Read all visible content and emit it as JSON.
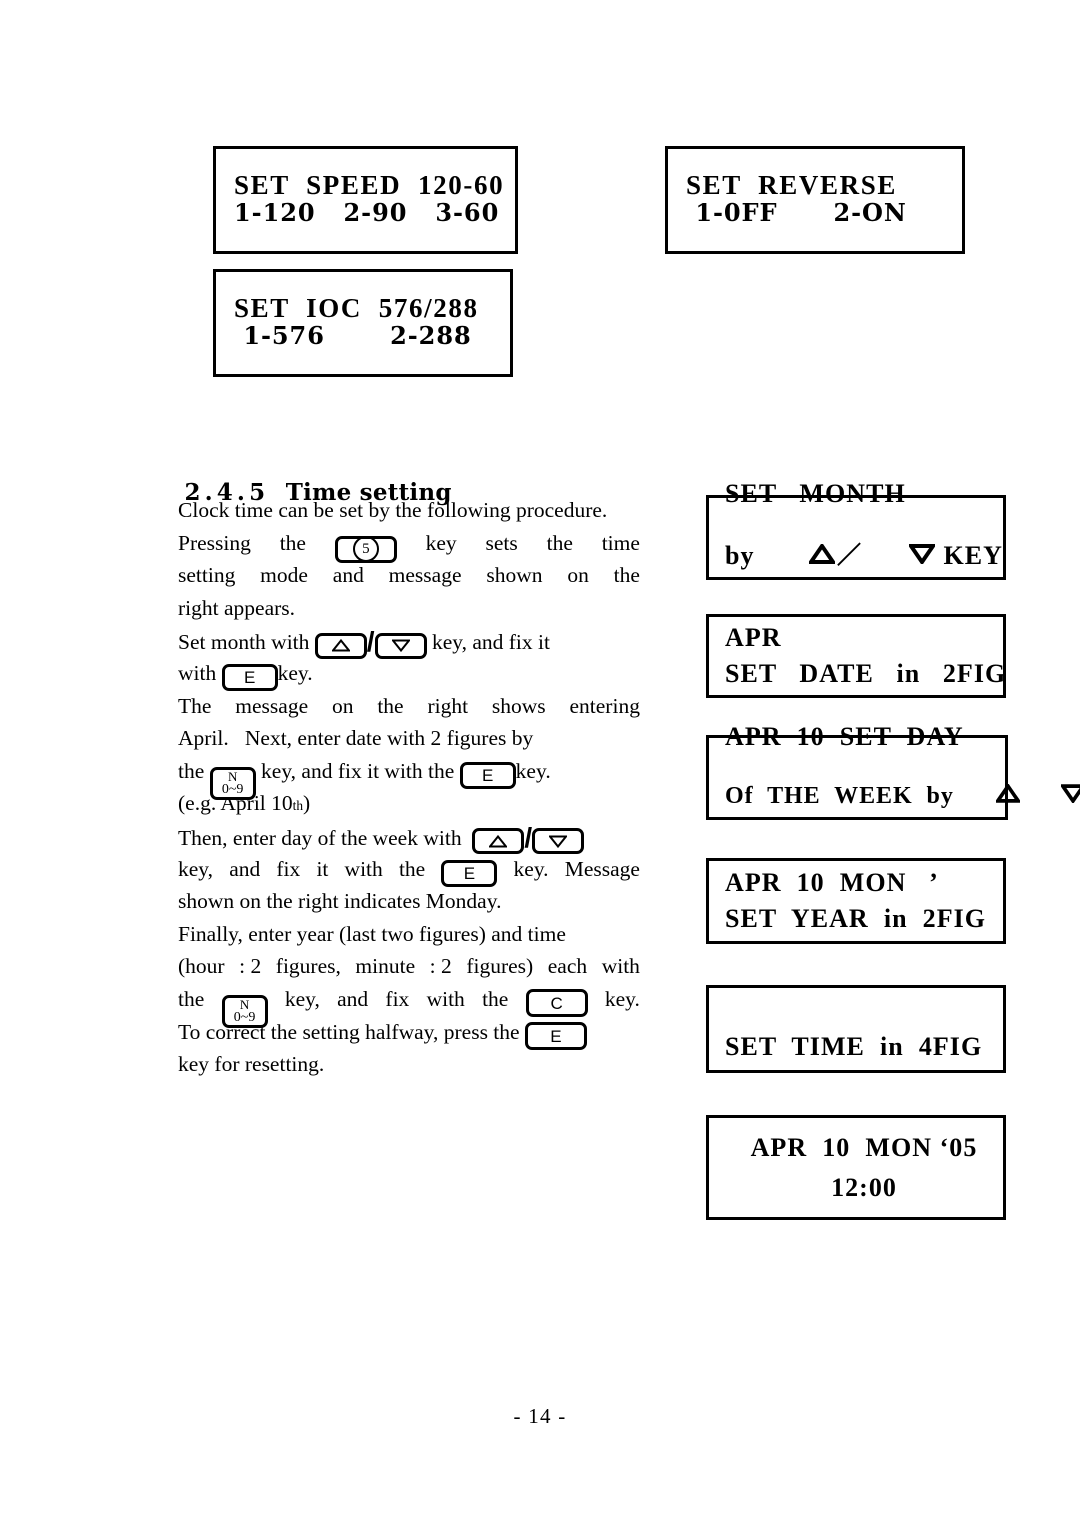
{
  "page": {
    "footer": "- 14 -"
  },
  "top_displays": [
    {
      "id": "set-speed",
      "line1": "SET  SPEED  120-60",
      "line2": "1-120   2-90   3-60"
    },
    {
      "id": "set-reverse",
      "line1": "SET  REVERSE",
      "line2": " 1-0FF      2-ON"
    },
    {
      "id": "set-ioc",
      "line1": "SET  IOC  576/288",
      "line2": " 1-576       2-288"
    }
  ],
  "section": {
    "number": "2.4.5",
    "title": "Time setting"
  },
  "body": {
    "p1": {
      "l1": "Clock time can be set by the following procedure.",
      "l2_a": "Pressing",
      "l2_b": "the",
      "l2_c": "key",
      "l2_d": "sets",
      "l2_e": "the",
      "l2_f": "time",
      "l3_a": "setting",
      "l3_b": "mode",
      "l3_c": "and",
      "l3_d": "message",
      "l3_e": "shown",
      "l3_f": "on",
      "l3_g": "the",
      "l4": "right appears."
    },
    "p2": {
      "l1_a": "Set month with",
      "l1_b": "key, and fix it",
      "l2_a": "with",
      "l2_b": "key."
    },
    "p3": {
      "l1_a": "The",
      "l1_b": "message",
      "l1_c": "on",
      "l1_d": "the",
      "l1_e": "right",
      "l1_f": "shows",
      "l1_g": "entering",
      "l2": "April.   Next, enter date with 2 figures by",
      "l3_a": "the",
      "l3_b": "key, and fix it with the",
      "l3_c": "key.",
      "l4_a": "(e.g. April 10",
      "l4_sup": "th",
      "l4_b": ")",
      "l5_a": "Then, enter day of the week with",
      "l6_a": "key,",
      "l6_b": "and",
      "l6_c": "fix",
      "l6_d": "it",
      "l6_e": "with",
      "l6_f": "the",
      "l6_g": "key.",
      "l6_h": "Message",
      "l7": "shown on the right indicates Monday."
    },
    "p4": {
      "l1": "Finally, enter year (last two figures) and time",
      "l2_a": "(hour",
      "l2_b": ": 2",
      "l2_c": "figures,",
      "l2_d": "minute",
      "l2_e": ": 2",
      "l2_f": "figures)",
      "l2_g": "each",
      "l2_h": "with",
      "l3_a": "the",
      "l3_b": "key,",
      "l3_c": "and",
      "l3_d": "fix",
      "l3_e": "with",
      "l3_f": "the",
      "l3_g": "key.",
      "l4_a": "To correct the setting halfway, press the",
      "l5": "key for resetting."
    }
  },
  "keys": {
    "five": "5",
    "enter": "E",
    "clear": "C",
    "numeric_top": "N",
    "numeric_bottom": "0~9",
    "slash": "/"
  },
  "right_displays": [
    {
      "id": "set-month",
      "line1": "SET   MONTH",
      "line2_pre": "by",
      "line2_post": "KEY",
      "arrows": "up-slash-down"
    },
    {
      "id": "set-date",
      "line1": "APR",
      "line2": "SET   DATE   in   2FIG",
      "arrows": "none"
    },
    {
      "id": "set-day",
      "line1": "APR  10  SET  DAY",
      "line2_pre": "Of  THE  WEEK  by",
      "arrows": "up-down"
    },
    {
      "id": "set-year",
      "line1": "APR  10  MON   ’",
      "line2": "SET  YEAR  in  2FIG",
      "arrows": "none"
    },
    {
      "id": "set-time",
      "line1": "",
      "line2": "SET  TIME  in  4FIG",
      "arrows": "none"
    },
    {
      "id": "clock-result",
      "line1": "APR  10  MON ‘05",
      "line2": "12:00",
      "arrows": "none"
    }
  ]
}
